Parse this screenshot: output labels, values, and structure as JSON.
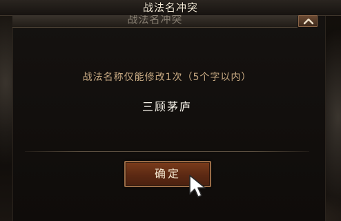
{
  "dialog": {
    "title": "战法名冲突",
    "message": "战法名称仅能修改1次（5个字以内）",
    "tactic_name": "三顾茅庐",
    "confirm_label": "确定"
  },
  "colors": {
    "title_text": "#f4ead6",
    "message_text": "#c7a982",
    "name_text": "#f5f1e8",
    "button_fill": "#5c2913",
    "button_border": "#9a6c46"
  },
  "icons": {
    "collapse": "chevron-up-icon",
    "cursor": "mouse-pointer-icon"
  }
}
